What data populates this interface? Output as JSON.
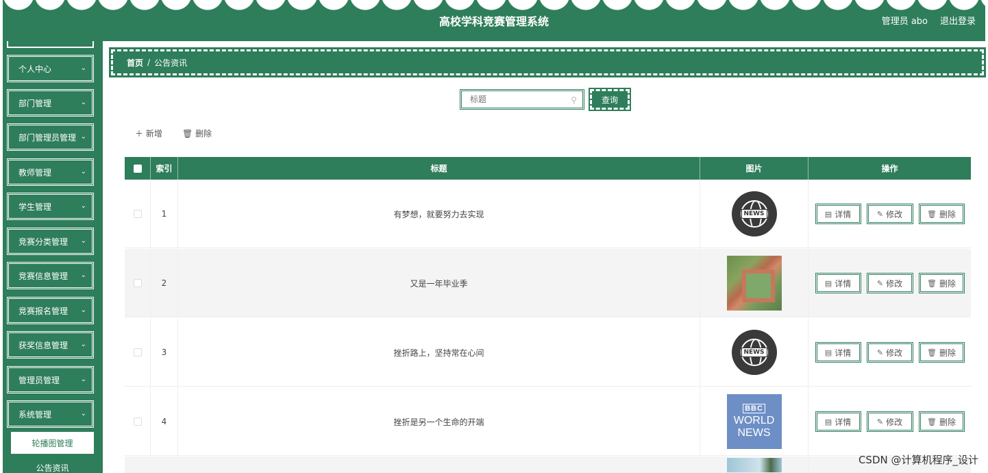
{
  "header": {
    "title": "高校学科竞赛管理系统",
    "admin_label": "管理员 abo",
    "logout_label": "退出登录"
  },
  "sidebar": {
    "items": [
      {
        "label": "个人中心"
      },
      {
        "label": "部门管理"
      },
      {
        "label": "部门管理员管理"
      },
      {
        "label": "教师管理"
      },
      {
        "label": "学生管理"
      },
      {
        "label": "竞赛分类管理"
      },
      {
        "label": "竞赛信息管理"
      },
      {
        "label": "竞赛报名管理"
      },
      {
        "label": "获奖信息管理"
      },
      {
        "label": "管理员管理"
      },
      {
        "label": "系统管理"
      }
    ],
    "submenu": [
      {
        "label": "轮播图管理"
      },
      {
        "label": "公告资讯"
      }
    ]
  },
  "breadcrumb": {
    "home": "首页",
    "separator": "/",
    "current": "公告资讯"
  },
  "search": {
    "placeholder": "标题",
    "button_label": "查询"
  },
  "actions": {
    "add_label": "新增",
    "delete_label": "删除"
  },
  "table": {
    "headers": {
      "index": "索引",
      "title": "标题",
      "picture": "图片",
      "operation": "操作"
    },
    "rows": [
      {
        "index": "1",
        "title": "有梦想，就要努力去实现",
        "picture": "news-globe"
      },
      {
        "index": "2",
        "title": "又是一年毕业季",
        "picture": "campus-building"
      },
      {
        "index": "3",
        "title": "挫折路上，坚持常在心间",
        "picture": "news-globe"
      },
      {
        "index": "4",
        "title": "挫折是另一个生命的开端",
        "picture": "bbc-world-news"
      }
    ],
    "op_labels": {
      "detail": "详情",
      "edit": "修改",
      "delete": "删除"
    },
    "news_tag": "NEWS",
    "bbc_image_text": {
      "top": "BBC",
      "line1": "WORLD",
      "line2": "NEWS"
    }
  },
  "watermark": "CSDN @计算机程序_设计",
  "colors": {
    "primary": "#2e7d5b",
    "background": "#ffffff"
  }
}
